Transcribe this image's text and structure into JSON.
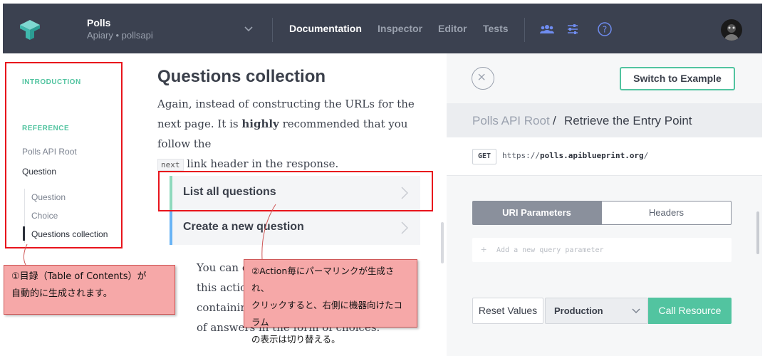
{
  "header": {
    "project_title": "Polls",
    "project_subtitle": "Apiary • pollsapi",
    "nav": [
      "Documentation",
      "Inspector",
      "Editor",
      "Tests"
    ],
    "active_nav": "Documentation",
    "icons": [
      "team-icon",
      "settings-sliders-icon",
      "help-icon"
    ]
  },
  "sidebar": {
    "intro_heading": "INTRODUCTION",
    "reference_heading": "REFERENCE",
    "items": [
      "Polls API Root",
      "Question"
    ],
    "sub_items": [
      "Question",
      "Choice",
      "Questions collection"
    ],
    "current": "Questions collection"
  },
  "content": {
    "title": "Questions collection",
    "para_before": "Again, instead of constructing the URLs for the next page. It is",
    "para_bold": "highly",
    "para_after": "recommended that you follow the",
    "code": "next",
    "para_end": "link header in the response.",
    "actions": [
      {
        "label": "List all questions",
        "color": "#8fd9bd"
      },
      {
        "label": "Create a new question",
        "color": "#69b4f5"
      }
    ],
    "para2": "You can c\nthis action\ncontainin\nof answers in the form of choices."
  },
  "right_panel": {
    "switch_label": "Switch to Example",
    "crumb_root": "Polls API Root",
    "crumb_sep": "/",
    "crumb_current": "Retrieve the Entry Point",
    "method": "GET",
    "url_prefix": "https://",
    "url_host": "polls.apiblueprint.org",
    "url_suffix": "/",
    "tabs": [
      "URI Parameters",
      "Headers"
    ],
    "query_placeholder": "Add a new query parameter",
    "reset_label": "Reset Values",
    "environment": "Production",
    "call_label": "Call Resource"
  },
  "annotations": {
    "note1": "①目録（Table of Contents）が\n自動的に生成されます。",
    "note2": "②Action毎にパーマリンクが生成され、\nクリックすると、右側に機器向けたコラム\nの表示は切り替える。"
  },
  "colors": {
    "topbar": "#3b4150",
    "accent": "#52c4a0",
    "annotation_red": "#e8141c",
    "note_fill": "#f6a8a8"
  }
}
